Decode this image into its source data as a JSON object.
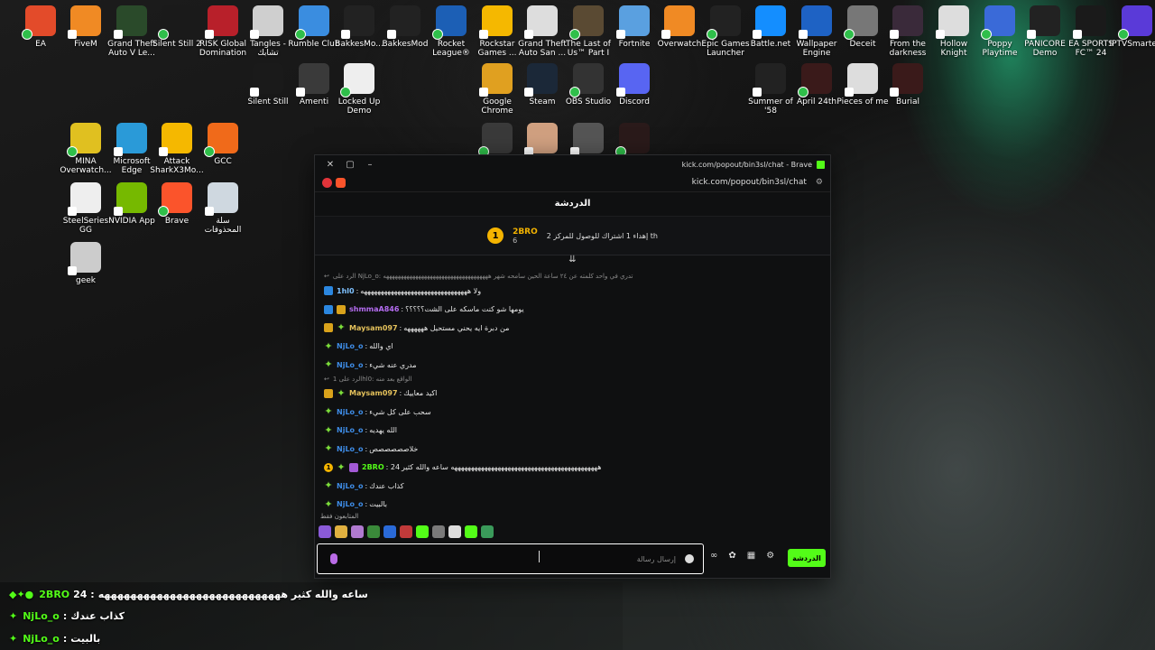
{
  "desktop": {
    "icons": [
      {
        "label": "EA",
        "color": "#e34b2a"
      },
      {
        "label": "FiveM",
        "color": "#f08a24"
      },
      {
        "label": "Grand Theft\nAuto V Le...",
        "color": "#2a4a2a"
      },
      {
        "label": "Silent Still 2",
        "color": "#1a1a1a"
      },
      {
        "label": "RISK Global\nDomination",
        "color": "#b8202a"
      },
      {
        "label": "Tangles -\nتشابك",
        "color": "#cfcfcf"
      },
      {
        "label": "Rumble Club",
        "color": "#3a8de0"
      },
      {
        "label": "BakkesMo...",
        "color": "#222"
      },
      {
        "label": "BakkesMod",
        "color": "#222"
      },
      {
        "label": "Rocket\nLeague®",
        "color": "#1c5fb5"
      },
      {
        "label": "Rockstar\nGames ...",
        "color": "#f5b800"
      },
      {
        "label": "Grand Theft\nAuto San ...",
        "color": "#ddd"
      },
      {
        "label": "The Last of\nUs™ Part I",
        "color": "#5a4a33"
      },
      {
        "label": "Fortnite",
        "color": "#5aa0e0"
      },
      {
        "label": "Overwatch",
        "color": "#f08a24"
      },
      {
        "label": "Epic Games\nLauncher",
        "color": "#222"
      },
      {
        "label": "Battle.net",
        "color": "#148eff"
      },
      {
        "label": "Wallpaper\nEngine",
        "color": "#1e62c4"
      },
      {
        "label": "Deceit",
        "color": "#777"
      },
      {
        "label": "From the\ndarkness",
        "color": "#3a2a3a"
      },
      {
        "label": "Hollow\nKnight",
        "color": "#ddd"
      },
      {
        "label": "Poppy\nPlaytime",
        "color": "#3a6ad8"
      },
      {
        "label": "PANICORE\nDemo",
        "color": "#222"
      },
      {
        "label": "EA SPORTS\nFC™ 24",
        "color": "#1a1a1a"
      },
      {
        "label": "IPTVSmarte...",
        "color": "#5a3ad8"
      },
      {
        "label": "Silent Still",
        "color": "#1a1a1a"
      },
      {
        "label": "Amenti",
        "color": "#3a3a3a"
      },
      {
        "label": "Locked Up\nDemo",
        "color": "#eee"
      },
      {
        "label": "Google\nChrome",
        "color": "#e0a020"
      },
      {
        "label": "Steam",
        "color": "#1b2838"
      },
      {
        "label": "OBS Studio",
        "color": "#333"
      },
      {
        "label": "Discord",
        "color": "#5865f2"
      },
      {
        "label": "Summer of\n'58",
        "color": "#222"
      },
      {
        "label": "April 24th",
        "color": "#3a1a1a"
      },
      {
        "label": "Pieces of me",
        "color": "#ddd"
      },
      {
        "label": "Burial",
        "color": "#3a1a1a"
      },
      {
        "label": "MINA\nOverwatch...",
        "color": "#e0c020"
      },
      {
        "label": "Microsoft\nEdge",
        "color": "#2a9ad8"
      },
      {
        "label": "Attack\nSharkX3Mo...",
        "color": "#f5b800"
      },
      {
        "label": "GCC",
        "color": "#f06a1a"
      },
      {
        "label": "SteelSeries\nGG",
        "color": "#eee"
      },
      {
        "label": "NVIDIA App",
        "color": "#76b900"
      },
      {
        "label": "Brave",
        "color": "#fb542b"
      },
      {
        "label": "سلة\nالمحذوفات",
        "color": "#cfd8e0"
      },
      {
        "label": "geek",
        "color": "#ccc"
      },
      {
        "label": "",
        "color": "#3a3a3a"
      },
      {
        "label": "",
        "color": "#d0a080"
      },
      {
        "label": "",
        "color": "#555"
      },
      {
        "label": "",
        "color": "#2a1a1a"
      }
    ]
  },
  "browser": {
    "title": "kick.com/popout/bin3sl/chat - Brave",
    "url": "kick.com/popout/bin3sl/chat"
  },
  "chat": {
    "header": "الدردشة",
    "pinned": {
      "rank": "1",
      "user": "2BRO",
      "sub": "6",
      "text": "إهداء 1 اشتراك للوصول للمركز 2 th"
    },
    "reply1": "الرد على NjLo_o: تدري في واحد كلمته عن ٢٤ ساعة الحين سامحه شهر ههههههههههههههههههههههههههههههههههههه",
    "messages": [
      {
        "user": "1hl0",
        "sep": ":",
        "text": "ولا ههههههههههههههههههههههههههههههههه"
      },
      {
        "user": "shmmaA846",
        "sep": ":",
        "text": "يومها شو كنت ماسكه على الشت؟؟؟؟؟"
      },
      {
        "user": "Maysam097",
        "sep": ":",
        "text": "من دبرة ايه يحني مستحيل ههههههه"
      },
      {
        "user": "NjLo_o",
        "sep": ":",
        "text": "اي والله"
      },
      {
        "user": "NjLo_o",
        "sep": ":",
        "text": "مدري عنه شيء"
      }
    ],
    "reply2": "الرد على 1hl0: الواقع بعد منه",
    "messages2": [
      {
        "user": "Maysam097",
        "sep": ":",
        "text": "اكيد معاييك"
      },
      {
        "user": "NjLo_o",
        "sep": ":",
        "text": "سحب على كل شيء"
      },
      {
        "user": "NjLo_o",
        "sep": ":",
        "text": "الله يهديه"
      },
      {
        "user": "NjLo_o",
        "sep": ":",
        "text": "خلاصصصصصص"
      },
      {
        "user": "2BRO",
        "sep": ": 24",
        "text": "ههههههههههههههههههههههههههههههههههههههههههههه ساعه والله كثير"
      },
      {
        "user": "NjLo_o",
        "sep": ":",
        "text": "كذاب عندك"
      },
      {
        "user": "NjLo_o",
        "sep": ":",
        "text": "بالبيت"
      }
    ],
    "emotes_title": "المتابعون فقط",
    "input_placeholder": "إرسال رسالة",
    "send_label": "الدردشة"
  },
  "overlay": [
    {
      "user": "2BRO",
      "prefix": "24 :",
      "text": "ساعه والله كثير ههههههههههههههههههههههههههههه"
    },
    {
      "user": "NjLo_o",
      "prefix": ":",
      "text": "كذاب عندك"
    },
    {
      "user": "NjLo_o",
      "prefix": ":",
      "text": "بالبيت"
    }
  ]
}
